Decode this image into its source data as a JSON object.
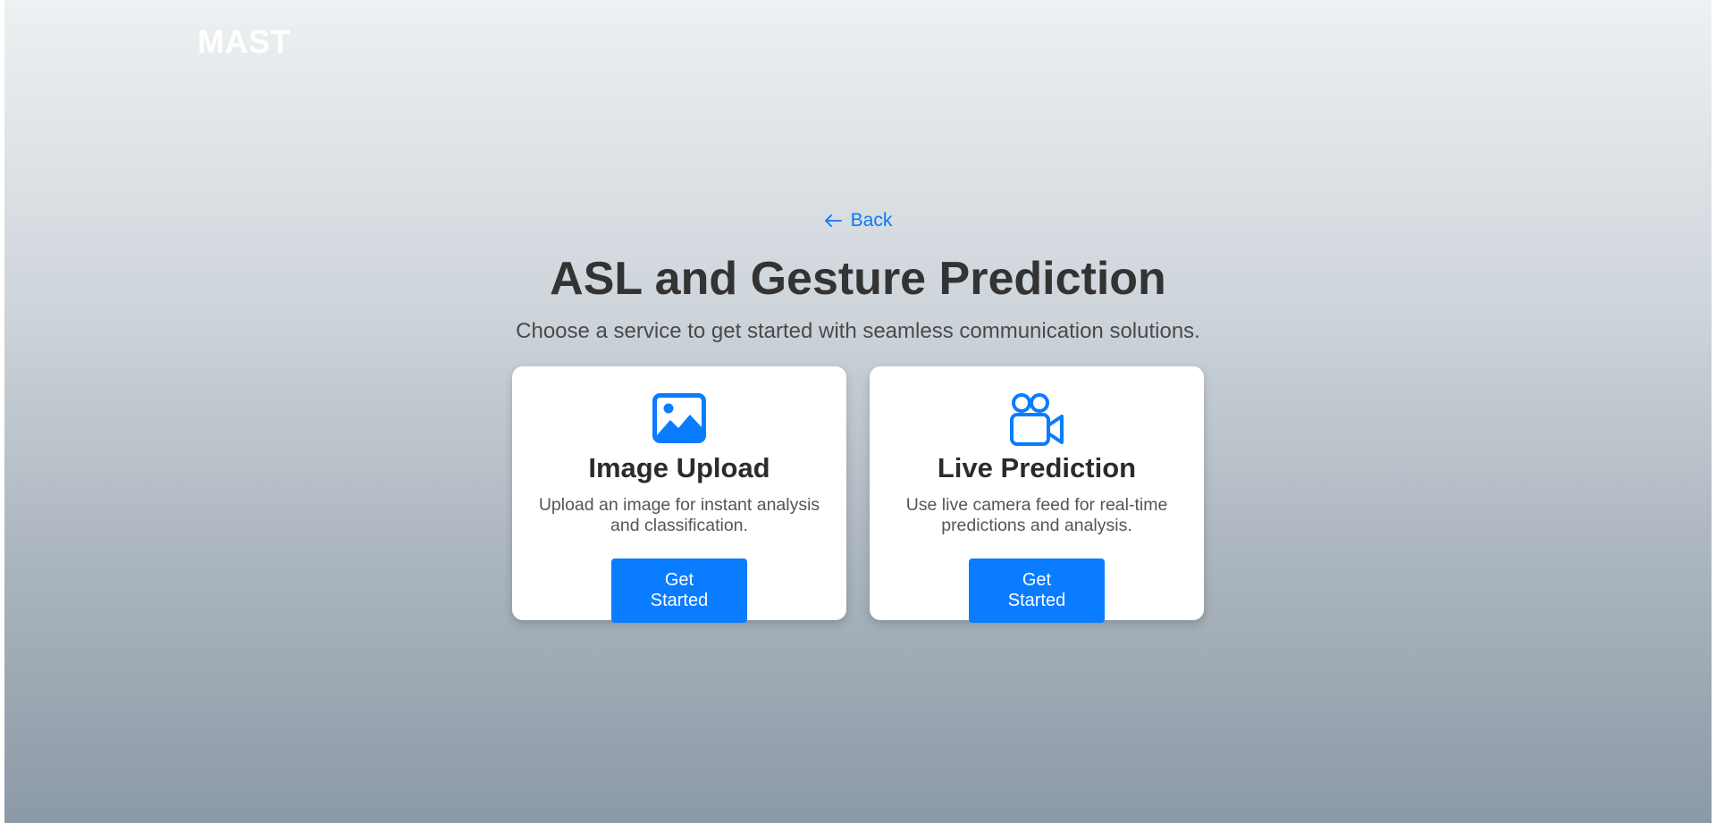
{
  "brand": "MAST",
  "back": {
    "label": "Back"
  },
  "heading": "ASL and Gesture Prediction",
  "subheading": "Choose a service to get started with seamless communication solutions.",
  "cards": [
    {
      "icon": "image-icon",
      "title": "Image Upload",
      "description": "Upload an image for instant analysis and classification.",
      "button": "Get Started"
    },
    {
      "icon": "video-camera-icon",
      "title": "Live Prediction",
      "description": "Use live camera feed for real-time predictions and analysis.",
      "button": "Get Started"
    }
  ],
  "colors": {
    "accent": "#0a7cff",
    "heading": "#333333",
    "link": "#0d78f2"
  }
}
